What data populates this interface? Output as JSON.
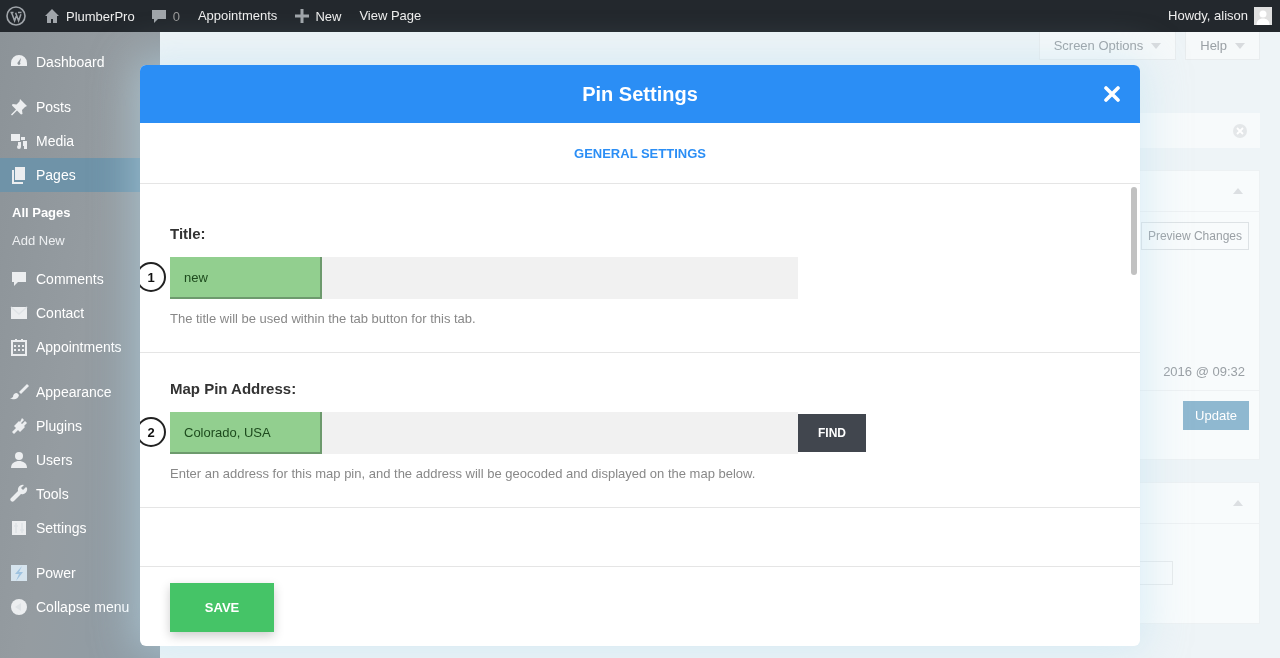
{
  "admin_bar": {
    "items": [
      {
        "kind": "logo"
      },
      {
        "kind": "site",
        "label": "PlumberPro"
      },
      {
        "kind": "comments",
        "label": "0"
      },
      {
        "kind": "link",
        "label": "Appointments"
      },
      {
        "kind": "new",
        "label": "New"
      },
      {
        "kind": "link",
        "label": "View Page"
      }
    ],
    "greeting": "Howdy, alison"
  },
  "sidebar": {
    "groups": [
      {
        "items": [
          {
            "label": "Dashboard",
            "selected": false
          }
        ]
      },
      {
        "items": [
          {
            "label": "Posts",
            "selected": false
          },
          {
            "label": "Media",
            "selected": false
          },
          {
            "label": "Pages",
            "selected": true,
            "submenu": [
              {
                "label": "All Pages",
                "selected": true
              },
              {
                "label": "Add New",
                "selected": false
              }
            ]
          },
          {
            "label": "Comments",
            "selected": false
          },
          {
            "label": "Contact",
            "selected": false
          },
          {
            "label": "Appointments",
            "selected": false
          }
        ]
      },
      {
        "items": [
          {
            "label": "Appearance",
            "selected": false
          },
          {
            "label": "Plugins",
            "selected": false
          },
          {
            "label": "Users",
            "selected": false
          },
          {
            "label": "Tools",
            "selected": false
          },
          {
            "label": "Settings",
            "selected": false
          }
        ]
      },
      {
        "items": [
          {
            "label": "Power",
            "selected": false
          },
          {
            "label": "Collapse menu",
            "selected": false
          }
        ]
      }
    ]
  },
  "background": {
    "screen_options": "Screen Options",
    "help": "Help",
    "preview_button": "Preview Changes",
    "published_date": "2016 @ 09:32",
    "update_button": "Update"
  },
  "modal": {
    "title": "Pin Settings",
    "tabs": [
      {
        "label": "GENERAL SETTINGS",
        "selected": true
      }
    ],
    "fields": [
      {
        "marker": "1",
        "label": "Title:",
        "value": "new",
        "help": "The title will be used within the tab button for this tab."
      },
      {
        "marker": "2",
        "label": "Map Pin Address:",
        "value": "Colorado, USA",
        "button": "FIND",
        "help": "Enter an address for this map pin, and the address will be geocoded and displayed on the map below."
      }
    ],
    "save_button": "SAVE"
  }
}
